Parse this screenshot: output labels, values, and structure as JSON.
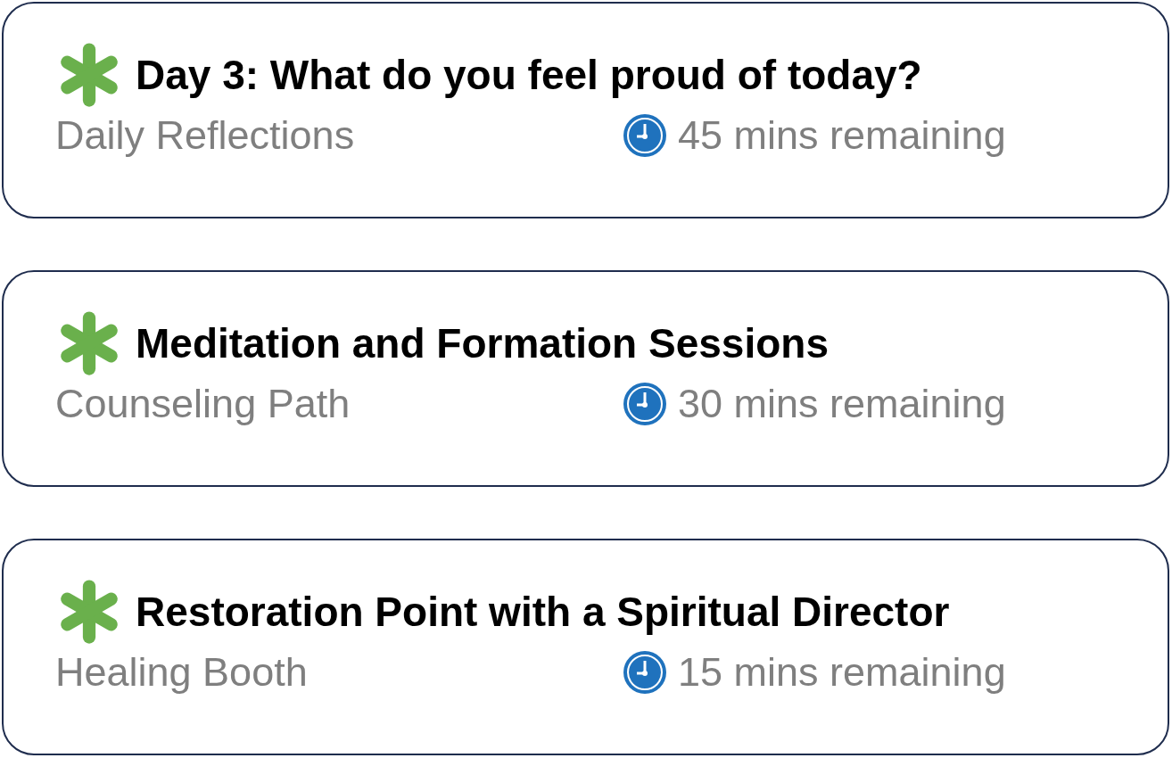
{
  "cards": [
    {
      "title": "Day 3: What do you feel proud of today?",
      "category": "Daily Reflections",
      "time": "45 mins remaining"
    },
    {
      "title": "Meditation and Formation Sessions",
      "category": "Counseling Path",
      "time": "30 mins remaining"
    },
    {
      "title": "Restoration Point with a Spiritual Director",
      "category": "Healing Booth",
      "time": "15 mins remaining"
    }
  ]
}
